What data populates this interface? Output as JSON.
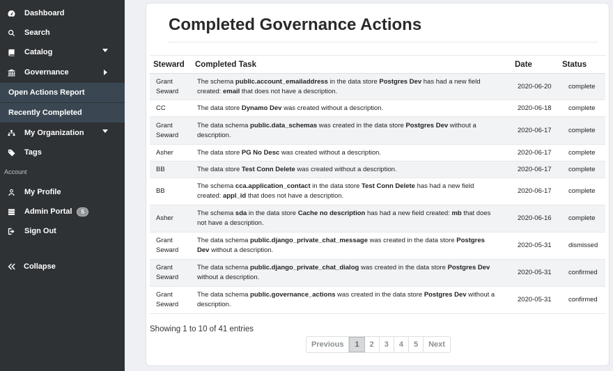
{
  "sidebar": {
    "items": [
      {
        "label": "Dashboard",
        "icon": "dashboard-icon"
      },
      {
        "label": "Search",
        "icon": "search-icon"
      },
      {
        "label": "Catalog",
        "icon": "book-icon"
      },
      {
        "label": "Governance",
        "icon": "institution-icon"
      },
      {
        "label": "My Organization",
        "icon": "sitemap-icon"
      },
      {
        "label": "Tags",
        "icon": "tag-icon"
      }
    ],
    "sub_items": [
      "Open Actions Report",
      "Recently Completed"
    ],
    "account_heading": "Account",
    "account_items": [
      {
        "label": "My Profile",
        "icon": "user-icon"
      },
      {
        "label": "Admin Portal",
        "icon": "server-icon",
        "badge": "5"
      },
      {
        "label": "Sign Out",
        "icon": "sign-out-icon"
      }
    ],
    "collapse": "Collapse"
  },
  "main": {
    "title": "Completed Governance Actions",
    "columns": [
      "Steward",
      "Completed Task",
      "Date",
      "Status"
    ],
    "rows": [
      {
        "steward": "Grant Seward",
        "task": "The schema <b>public.account_emailaddress</b> in the data store <b>Postgres Dev</b> has had a new field created: <b>email</b> that does not have a description.",
        "date": "2020-06-20",
        "status": "complete"
      },
      {
        "steward": "CC",
        "task": "The data store <b>Dynamo Dev</b> was created without a description.",
        "date": "2020-06-18",
        "status": "complete"
      },
      {
        "steward": "Grant Seward",
        "task": "The data schema <b>public.data_schemas</b> was created in the data store <b>Postgres Dev</b> without a description.",
        "date": "2020-06-17",
        "status": "complete"
      },
      {
        "steward": "Asher",
        "task": "The data store <b>PG No Desc</b> was created without a description.",
        "date": "2020-06-17",
        "status": "complete"
      },
      {
        "steward": "BB",
        "task": "The data store <b>Test Conn Delete</b> was created without a description.",
        "date": "2020-06-17",
        "status": "complete"
      },
      {
        "steward": "BB",
        "task": "The schema <b>cca.application_contact</b> in the data store <b>Test Conn Delete</b> has had a new field created: <b>appl_id</b> that does not have a description.",
        "date": "2020-06-17",
        "status": "complete"
      },
      {
        "steward": "Asher",
        "task": "The schema <b>sda</b> in the data store <b>Cache no description</b> has had a new field created: <b>mb</b> that does not have a description.",
        "date": "2020-06-16",
        "status": "complete"
      },
      {
        "steward": "Grant Seward",
        "task": "The data schema <b>public.django_private_chat_message</b> was created in the data store <b>Postgres Dev</b> without a description.",
        "date": "2020-05-31",
        "status": "dismissed"
      },
      {
        "steward": "Grant Seward",
        "task": "The data schema <b>public.django_private_chat_dialog</b> was created in the data store <b>Postgres Dev</b> without a description.",
        "date": "2020-05-31",
        "status": "confirmed"
      },
      {
        "steward": "Grant Seward",
        "task": "The data schema <b>public.governance_actions</b> was created in the data store <b>Postgres Dev</b> without a description.",
        "date": "2020-05-31",
        "status": "confirmed"
      }
    ],
    "info": "Showing 1 to 10 of 41 entries",
    "pagination": {
      "previous": "Previous",
      "pages": [
        "1",
        "2",
        "3",
        "4",
        "5"
      ],
      "current": "1",
      "next": "Next"
    }
  }
}
